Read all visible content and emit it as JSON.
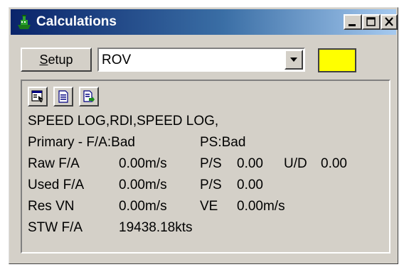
{
  "window": {
    "title": "Calculations"
  },
  "toolbar": {
    "setup_label": "Setup",
    "setup_mnemonic": "S",
    "source_value": "ROV",
    "indicator_color": "#ffff00"
  },
  "panel": {
    "icons": [
      "properties-icon",
      "document-icon",
      "export-icon"
    ],
    "sensors_line": "SPEED LOG,RDI,SPEED LOG,",
    "primary": {
      "label": "Primary - F/A:Bad",
      "ps": "PS:Bad"
    },
    "raw": {
      "label": "Raw F/A",
      "fa": "0.00m/s",
      "ps_label": "P/S",
      "ps": "0.00",
      "ud_label": "U/D",
      "ud": "0.00"
    },
    "used": {
      "label": "Used F/A",
      "fa": "0.00m/s",
      "ps_label": "P/S",
      "ps": "0.00"
    },
    "res": {
      "label": "Res VN",
      "vn": "0.00m/s",
      "ve_label": "VE",
      "ve": "0.00m/s"
    },
    "stw": {
      "label": "STW F/A",
      "value": "19438.18kts"
    }
  }
}
